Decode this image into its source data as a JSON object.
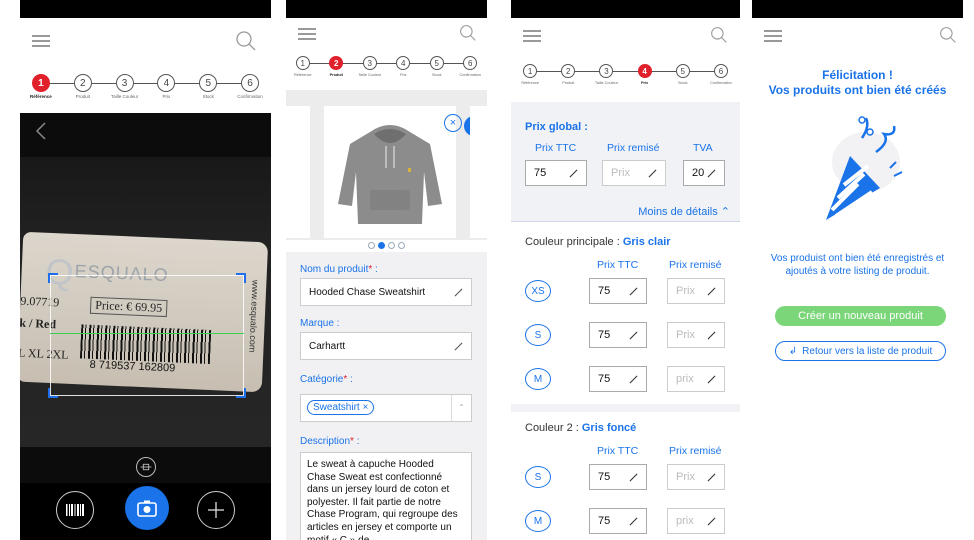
{
  "steps": [
    {
      "num": "1",
      "label": "Référence"
    },
    {
      "num": "2",
      "label": "Produit"
    },
    {
      "num": "3",
      "label": "Taille Couleur"
    },
    {
      "num": "4",
      "label": "Prix"
    },
    {
      "num": "5",
      "label": "Stock"
    },
    {
      "num": "6",
      "label": "Confirmation"
    }
  ],
  "colors": {
    "accent": "#1a73e8",
    "active_step": "#e0202a",
    "success": "#7bd67a",
    "scan_line": "#39d353"
  },
  "screen1": {
    "active_step": 1,
    "tag": {
      "brand": "ESQUALO",
      "ref": "9.07719",
      "price": "Price: € 69.95",
      "color": "k / Red",
      "sizes": "L  XL  2XL",
      "barcode_number": "8 719537 162809",
      "site": "www.esqualo.com"
    }
  },
  "screen2": {
    "active_step": 2,
    "carousel_total": 4,
    "carousel_index": 1,
    "product_name_label": "Nom du produit",
    "product_name_value": "Hooded Chase Sweatshirt",
    "brand_label": "Marque :",
    "brand_value": "Carhartt",
    "category_label": "Catégorie",
    "category_chip": "Sweatshirt",
    "description_label": "Description",
    "description_value": "Le sweat à capuche Hooded Chase Sweat est confectionné dans un jersey lourd de coton et polyester. Il fait partie de notre Chase Program, qui regroupe des articles en jersey et comporte un motif « C » de"
  },
  "screen3": {
    "active_step": 4,
    "global_title": "Prix global :",
    "col_ttc": "Prix TTC",
    "col_remise": "Prix remisé",
    "col_tva": "TVA",
    "global_ttc": "75",
    "global_remise_placeholder": "Prix",
    "global_tva": "20",
    "less_details": "Moins de détails",
    "color1_label": "Couleur principale :",
    "color1_name": "Gris clair",
    "color1_rows": [
      {
        "size": "XS",
        "ttc": "75",
        "remise": "Prix"
      },
      {
        "size": "S",
        "ttc": "75",
        "remise": "Prix"
      },
      {
        "size": "M",
        "ttc": "75",
        "remise": "prix"
      }
    ],
    "color2_label": "Couleur 2 :",
    "color2_name": "Gris foncé",
    "color2_rows": [
      {
        "size": "S",
        "ttc": "75",
        "remise": "Prix"
      },
      {
        "size": "M",
        "ttc": "75",
        "remise": "prix"
      }
    ]
  },
  "screen4": {
    "title": "Félicitation !\nVos produits ont bien été créés",
    "description": "Vos produist ont bien été enregistrés et ajoutés à votre listing de produit.",
    "btn_new": "Créer un nouveau produit",
    "btn_back": "Retour vers la liste de produit"
  }
}
